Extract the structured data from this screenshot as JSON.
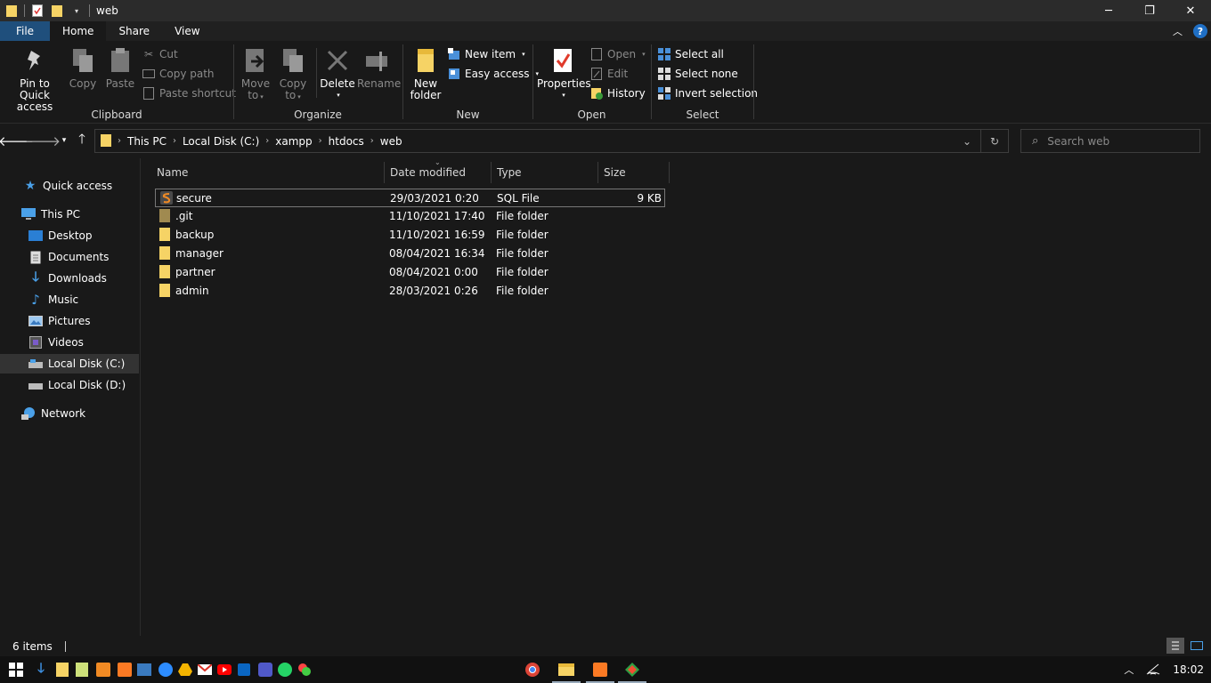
{
  "window": {
    "title": "web"
  },
  "tabs": {
    "file": "File",
    "home": "Home",
    "share": "Share",
    "view": "View"
  },
  "ribbon": {
    "clipboard": {
      "label": "Clipboard",
      "pin": "Pin to Quick access",
      "pin_l1": "Pin to Quick",
      "pin_l2": "access",
      "copy": "Copy",
      "paste": "Paste",
      "cut": "Cut",
      "copy_path": "Copy path",
      "paste_shortcut": "Paste shortcut"
    },
    "organize": {
      "label": "Organize",
      "move_l1": "Move",
      "move_l2": "to",
      "copy_l1": "Copy",
      "copy_l2": "to",
      "delete": "Delete",
      "rename": "Rename"
    },
    "new": {
      "label": "New",
      "new_folder_l1": "New",
      "new_folder_l2": "folder",
      "new_item": "New item",
      "easy_access": "Easy access"
    },
    "open": {
      "label": "Open",
      "properties": "Properties",
      "open": "Open",
      "edit": "Edit",
      "history": "History"
    },
    "select": {
      "label": "Select",
      "select_all": "Select all",
      "select_none": "Select none",
      "invert": "Invert selection"
    }
  },
  "address": {
    "crumbs": [
      "This PC",
      "Local Disk (C:)",
      "xampp",
      "htdocs",
      "web"
    ]
  },
  "search": {
    "placeholder": "Search web"
  },
  "sidebar": {
    "items": [
      {
        "label": "Quick access",
        "icon": "star-icon"
      },
      {
        "label": "This PC",
        "icon": "computer-icon"
      },
      {
        "label": "Desktop",
        "icon": "desktop-icon"
      },
      {
        "label": "Documents",
        "icon": "documents-icon"
      },
      {
        "label": "Downloads",
        "icon": "downloads-icon"
      },
      {
        "label": "Music",
        "icon": "music-icon"
      },
      {
        "label": "Pictures",
        "icon": "pictures-icon"
      },
      {
        "label": "Videos",
        "icon": "videos-icon"
      },
      {
        "label": "Local Disk (C:)",
        "icon": "drive-icon",
        "selected": true
      },
      {
        "label": "Local Disk (D:)",
        "icon": "drive-icon"
      },
      {
        "label": "Network",
        "icon": "network-icon"
      }
    ]
  },
  "columns": {
    "name": "Name",
    "date": "Date modified",
    "type": "Type",
    "size": "Size"
  },
  "files": [
    {
      "name": "secure",
      "date": "29/03/2021 0:20",
      "type": "SQL File",
      "size": "9 KB",
      "icon": "sql-file-icon",
      "selected": true
    },
    {
      "name": ".git",
      "date": "11/10/2021 17:40",
      "type": "File folder",
      "size": "",
      "icon": "folder-icon"
    },
    {
      "name": "backup",
      "date": "11/10/2021 16:59",
      "type": "File folder",
      "size": "",
      "icon": "folder-icon"
    },
    {
      "name": "manager",
      "date": "08/04/2021 16:34",
      "type": "File folder",
      "size": "",
      "icon": "folder-icon"
    },
    {
      "name": "partner",
      "date": "08/04/2021 0:00",
      "type": "File folder",
      "size": "",
      "icon": "folder-icon"
    },
    {
      "name": "admin",
      "date": "28/03/2021 0:26",
      "type": "File folder",
      "size": "",
      "icon": "folder-icon"
    }
  ],
  "status": {
    "count": "6 items"
  },
  "taskbar": {
    "time": "18:02"
  },
  "colors": {
    "folder": "#f6d365",
    "accent": "#1f4f7c",
    "selection": "#333333"
  }
}
